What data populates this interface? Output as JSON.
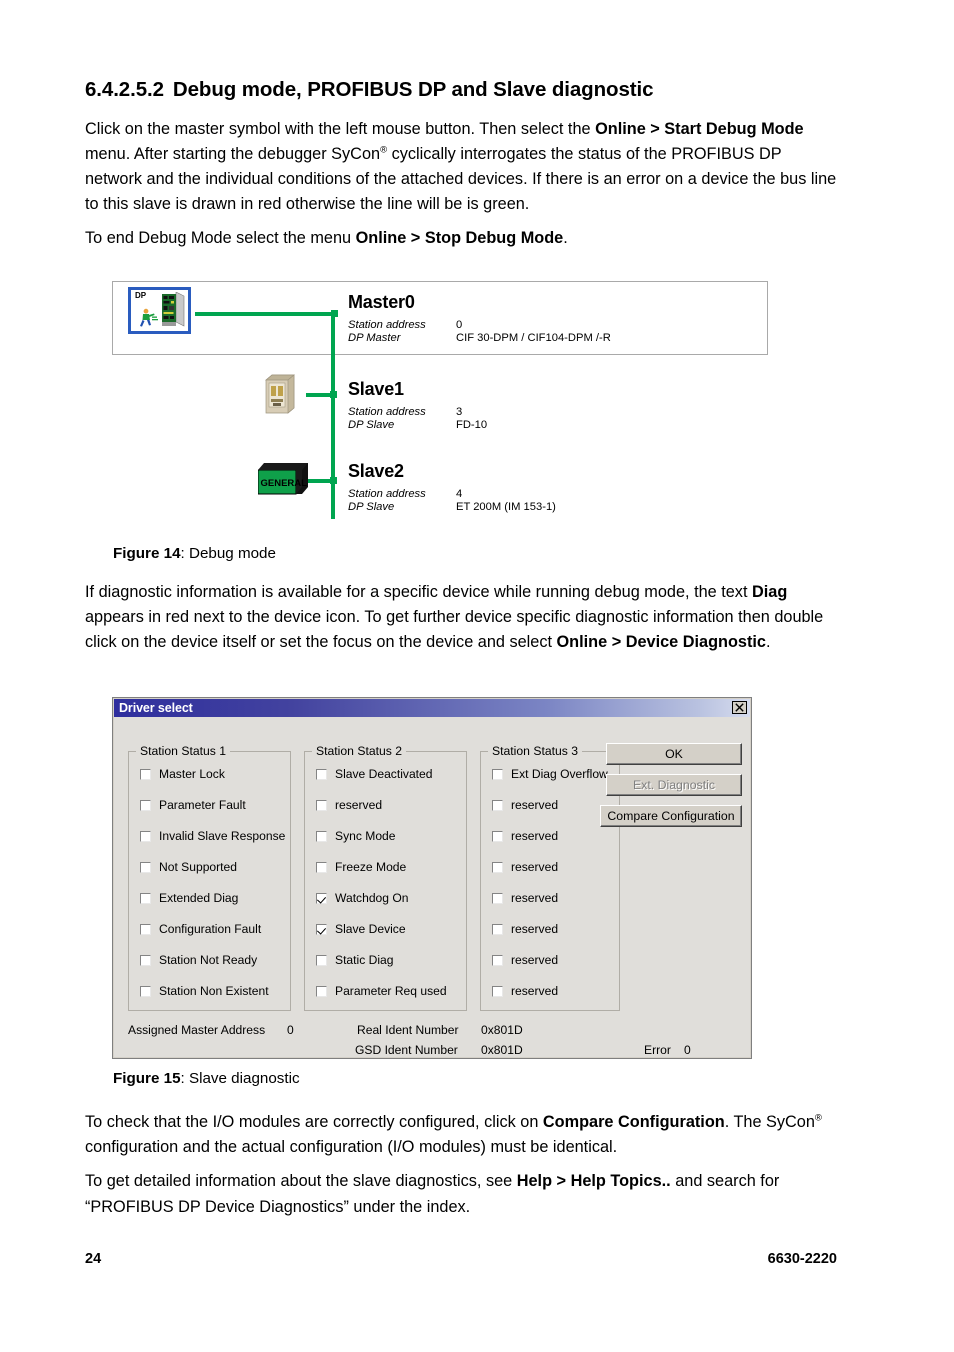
{
  "section": {
    "number": "6.4.2.5.2",
    "title": "Debug mode, PROFIBUS DP and Slave diagnostic"
  },
  "paragraphs": {
    "p1_a": "Click on the master symbol with the left mouse button. Then select the ",
    "p1_b1": "Online > Start Debug Mode",
    "p1_c": " menu. After starting the debugger SyCon",
    "p1_reg": "®",
    "p1_d": " cyclically interrogates the status of the PROFIBUS DP network and the individual conditions of the attached devices. If there is an error on a device the bus line to this slave is drawn in red otherwise the line will be is green.",
    "p2_a": "To end Debug Mode select the menu ",
    "p2_b": "Online > Stop Debug Mode",
    "p2_c": ".",
    "p3_a": "If diagnostic information is available for a specific device while running debug mode, the text ",
    "p3_b1": "Diag",
    "p3_c": " appears in red next to the device icon. To get further device specific diagnostic information then double click on the device itself or set the focus on the device and select ",
    "p3_b2": "Online > Device Diagnostic",
    "p3_d": ".",
    "p4_a": "To check that the I/O modules are correctly configured, click on ",
    "p4_b": "Compare Configuration",
    "p4_c": ". The SyCon",
    "p4_reg": "®",
    "p4_d": " configuration and the actual configuration (I/O modules) must be identical.",
    "p5_a": "To get detailed information about the slave diagnostics, see ",
    "p5_b": "Help > Help Topics..",
    "p5_c": " and search for “PROFIBUS DP Device Diagnostics” under the index."
  },
  "figure14": {
    "caption_label": "Figure 14",
    "caption_text": ": Debug mode",
    "bus_color": "#00A550",
    "master": {
      "name": "Master0",
      "icon_label": "DP",
      "props": [
        {
          "key": "Station address",
          "value": "0"
        },
        {
          "key": "DP Master",
          "value": "CIF 30-DPM / CIF104-DPM /-R"
        }
      ]
    },
    "slaves": [
      {
        "name": "Slave1",
        "props": [
          {
            "key": "Station address",
            "value": "3"
          },
          {
            "key": "DP Slave",
            "value": "FD-10"
          }
        ]
      },
      {
        "name": "Slave2",
        "icon_label": "GENERAL",
        "props": [
          {
            "key": "Station address",
            "value": "4"
          },
          {
            "key": "DP Slave",
            "value": "ET 200M (IM 153-1)"
          }
        ]
      }
    ]
  },
  "figure15": {
    "caption_label": "Figure 15",
    "caption_text": ": Slave diagnostic",
    "dialog": {
      "title": "Driver select",
      "close_glyph": "✕",
      "groups": [
        {
          "legend": "Station Status 1",
          "items": [
            {
              "label": "Master Lock",
              "checked": false
            },
            {
              "label": "Parameter Fault",
              "checked": false
            },
            {
              "label": "Invalid Slave Response",
              "checked": false
            },
            {
              "label": "Not Supported",
              "checked": false
            },
            {
              "label": "Extended Diag",
              "checked": false
            },
            {
              "label": "Configuration Fault",
              "checked": false
            },
            {
              "label": "Station Not Ready",
              "checked": false
            },
            {
              "label": "Station Non Existent",
              "checked": false
            }
          ]
        },
        {
          "legend": "Station Status 2",
          "items": [
            {
              "label": "Slave Deactivated",
              "checked": false
            },
            {
              "label": "reserved",
              "checked": false
            },
            {
              "label": "Sync Mode",
              "checked": false
            },
            {
              "label": "Freeze Mode",
              "checked": false
            },
            {
              "label": "Watchdog On",
              "checked": true
            },
            {
              "label": "Slave Device",
              "checked": true
            },
            {
              "label": "Static Diag",
              "checked": false
            },
            {
              "label": "Parameter Req used",
              "checked": false
            }
          ]
        },
        {
          "legend": "Station Status 3",
          "items": [
            {
              "label": "Ext Diag Overflow",
              "checked": false
            },
            {
              "label": "reserved",
              "checked": false
            },
            {
              "label": "reserved",
              "checked": false
            },
            {
              "label": "reserved",
              "checked": false
            },
            {
              "label": "reserved",
              "checked": false
            },
            {
              "label": "reserved",
              "checked": false
            },
            {
              "label": "reserved",
              "checked": false
            },
            {
              "label": "reserved",
              "checked": false
            }
          ]
        }
      ],
      "buttons": [
        {
          "label": "OK",
          "disabled": false
        },
        {
          "label": "Ext. Diagnostic",
          "disabled": true
        },
        {
          "label": "Compare Configuration",
          "disabled": false
        }
      ],
      "footer": {
        "assigned_master_address_label": "Assigned Master Address",
        "assigned_master_address_value": "0",
        "real_ident_label": "Real Ident Number",
        "real_ident_value": "0x801D",
        "gsd_ident_label": "GSD Ident Number",
        "gsd_ident_value": "0x801D",
        "error_label": "Error",
        "error_value": "0"
      }
    }
  },
  "page_footer": {
    "page_number": "24",
    "doc_number": "6630-2220"
  }
}
